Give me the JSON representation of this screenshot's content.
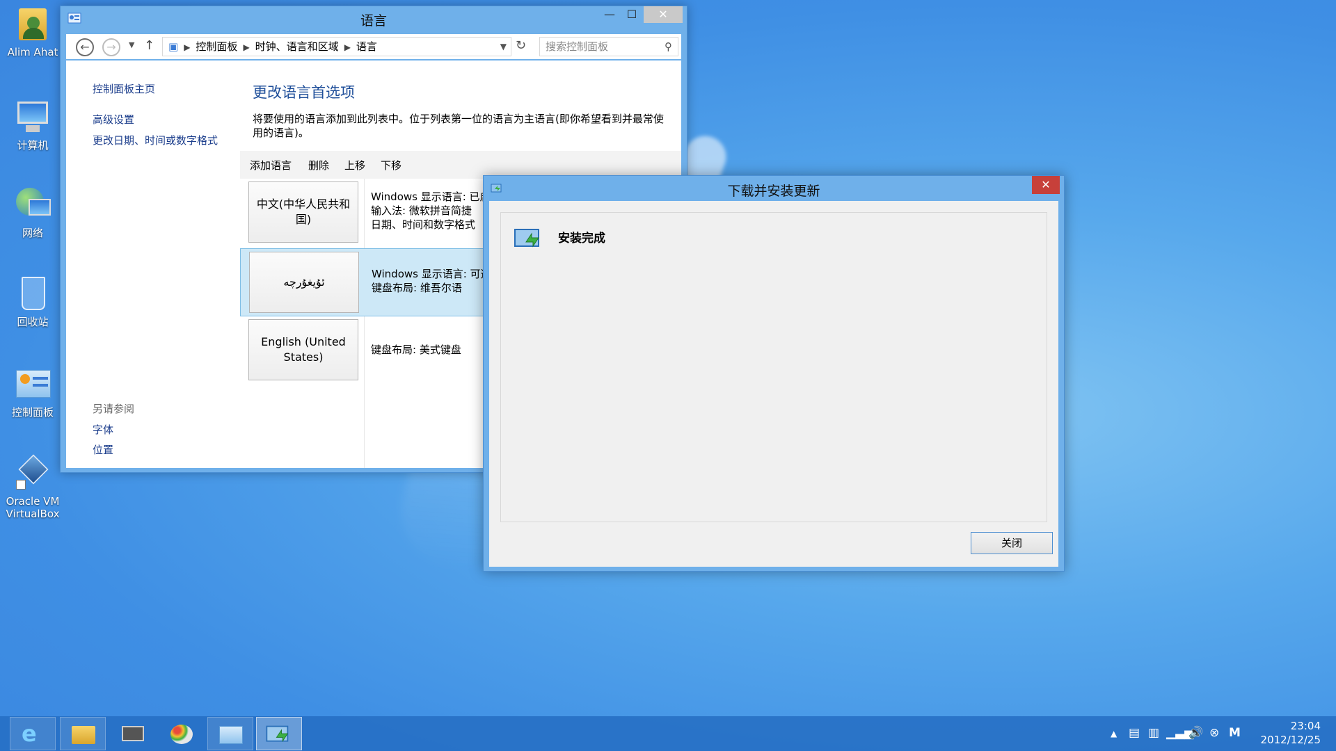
{
  "desktop": {
    "icons": [
      {
        "label": "Alim Ahat"
      },
      {
        "label": "计算机"
      },
      {
        "label": "网络"
      },
      {
        "label": "回收站"
      },
      {
        "label": "控制面板"
      },
      {
        "label": "Oracle VM VirtualBox"
      }
    ]
  },
  "language_window": {
    "title": "语言",
    "controls": {
      "minimize": "—",
      "maximize": "☐",
      "close": "✕"
    },
    "breadcrumb": [
      "控制面板",
      "时钟、语言和区域",
      "语言"
    ],
    "search_placeholder": "搜索控制面板",
    "left_nav": {
      "home": "控制面板主页",
      "advanced": "高级设置",
      "change_date": "更改日期、时间或数字格式",
      "see_also_heading": "另请参阅",
      "fonts": "字体",
      "location": "位置"
    },
    "heading": "更改语言首选项",
    "description": "将要使用的语言添加到此列表中。位于列表第一位的语言为主语言(即你希望看到并最常使用的语言)。",
    "toolbar": {
      "add": "添加语言",
      "remove": "删除",
      "move_up": "上移",
      "move_down": "下移"
    },
    "languages": [
      {
        "name": "中文(中华人民共和国)",
        "info": [
          "Windows 显示语言: 已启",
          "输入法: 微软拼音简捷",
          "日期、时间和数字格式"
        ]
      },
      {
        "name": "ئۇيغۇرچە",
        "info": [
          "Windows 显示语言: 可选",
          "键盘布局: 维吾尔语"
        ]
      },
      {
        "name": "English (United States)",
        "info": [
          "键盘布局: 美式键盘"
        ]
      }
    ]
  },
  "dialog": {
    "title": "下载并安装更新",
    "status": "安装完成",
    "close_button": "关闭",
    "close_x": "✕"
  },
  "taskbar": {
    "apps": [
      "internet-explorer",
      "file-explorer",
      "computer-management",
      "paint",
      "control-panel",
      "windows-update"
    ],
    "clock_time": "23:04",
    "clock_date": "2012/12/25",
    "ime_indicator": "M"
  },
  "colors": {
    "accent": "#6fb0ea",
    "link": "#1c3e8c",
    "heading": "#1e4e99",
    "selection": "#cde8f7",
    "close_red": "#c7403a"
  }
}
